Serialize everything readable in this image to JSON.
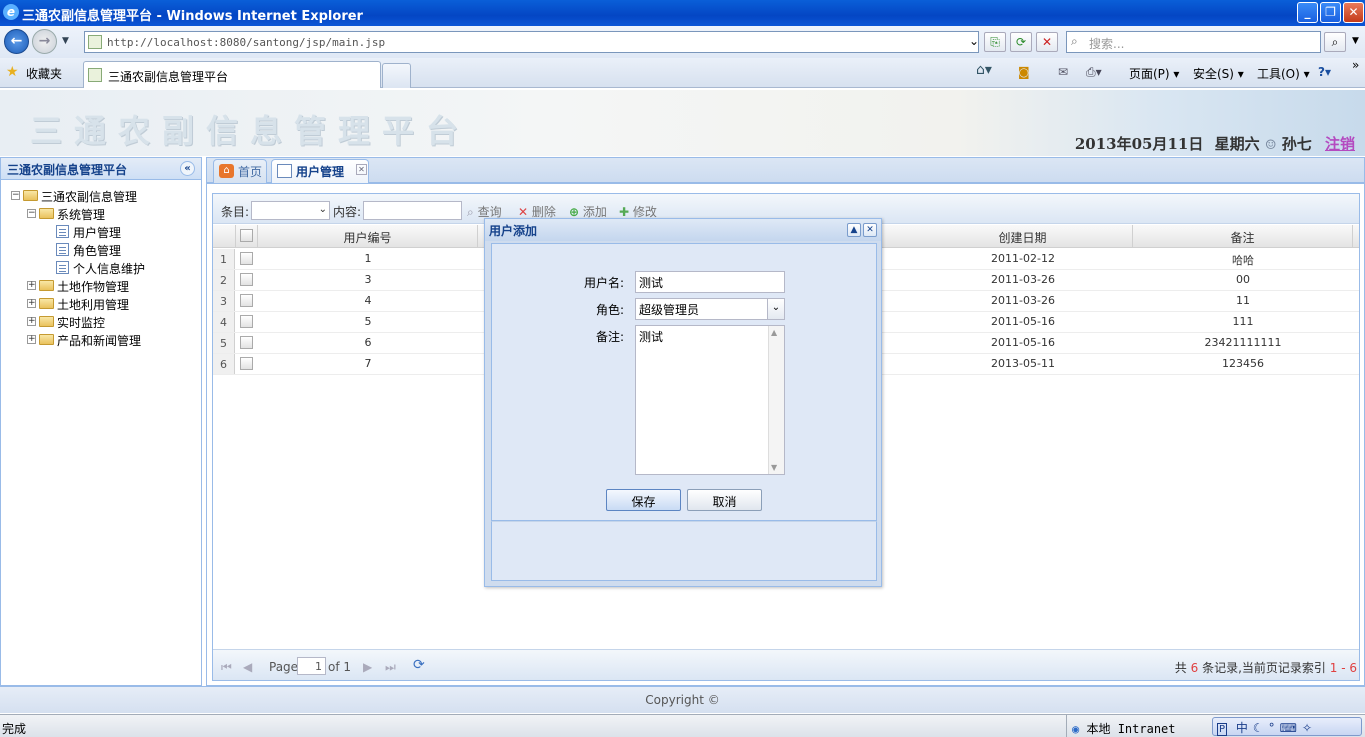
{
  "window": {
    "title": "三通农副信息管理平台 - Windows Internet Explorer",
    "controls": {
      "minimize": "_",
      "maximize": "❐",
      "close": "✕"
    }
  },
  "browser": {
    "url": "http://localhost:8080/santong/jsp/main.jsp",
    "search_placeholder": "搜索...",
    "favorites": "收藏夹",
    "tab_title": "三通农副信息管理平台",
    "commands": {
      "page": "页面(P)",
      "safety": "安全(S)",
      "tools": "工具(O)"
    }
  },
  "header": {
    "logo": "三通农副信息管理平台",
    "date": "2013年05月11日",
    "weekday": "星期六",
    "user": "孙七",
    "logout": "注销"
  },
  "sidebar": {
    "title": "三通农副信息管理平台",
    "collapse": "«",
    "tree": [
      {
        "label": "三通农副信息管理",
        "type": "folder",
        "pm": "−"
      },
      {
        "label": "系统管理",
        "type": "folder",
        "pm": "−"
      },
      {
        "label": "用户管理",
        "type": "leaf"
      },
      {
        "label": "角色管理",
        "type": "leaf"
      },
      {
        "label": "个人信息维护",
        "type": "leaf"
      },
      {
        "label": "土地作物管理",
        "type": "folder",
        "pm": "+"
      },
      {
        "label": "土地利用管理",
        "type": "folder",
        "pm": "+"
      },
      {
        "label": "实时监控",
        "type": "folder",
        "pm": "+"
      },
      {
        "label": "产品和新闻管理",
        "type": "folder",
        "pm": "+"
      }
    ]
  },
  "tabs": {
    "home": "首页",
    "active": "用户管理"
  },
  "toolbar": {
    "field_label": "条目:",
    "content_label": "内容:",
    "query": "查询",
    "delete": "删除",
    "add": "添加",
    "edit": "修改"
  },
  "grid": {
    "columns": {
      "user_id": "用户编号",
      "created": "创建日期",
      "remark": "备注"
    },
    "rows": [
      {
        "n": "1",
        "id": "1",
        "created": "2011-02-12",
        "remark": "哈哈"
      },
      {
        "n": "2",
        "id": "3",
        "created": "2011-03-26",
        "remark": "00"
      },
      {
        "n": "3",
        "id": "4",
        "created": "2011-03-26",
        "remark": "11"
      },
      {
        "n": "4",
        "id": "5",
        "created": "2011-05-16",
        "remark": "111"
      },
      {
        "n": "5",
        "id": "6",
        "created": "2011-05-16",
        "remark": "23421111111"
      },
      {
        "n": "6",
        "id": "7",
        "created": "2013-05-11",
        "remark": "123456"
      }
    ]
  },
  "pager": {
    "page_label": "Page",
    "page": "1",
    "of": "of 1",
    "summary_prefix": "共",
    "count": "6",
    "summary_mid": "条记录,当前页记录索引",
    "range": "1 - 6"
  },
  "footer": "Copyright ©",
  "dialog": {
    "title": "用户添加",
    "username_label": "用户名:",
    "username": "测试",
    "role_label": "角色:",
    "role": "超级管理员",
    "remark_label": "备注:",
    "remark": "测试",
    "save": "保存",
    "cancel": "取消"
  },
  "statusbar": {
    "status": "完成",
    "zone": "本地 Intranet",
    "ime": "中"
  }
}
